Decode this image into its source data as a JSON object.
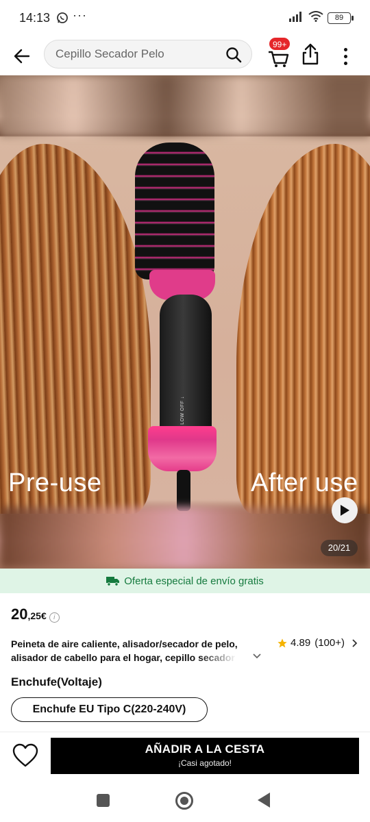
{
  "status_bar": {
    "time": "14:13",
    "battery": "89"
  },
  "header": {
    "search_placeholder": "Cepillo Secador Pelo",
    "cart_badge": "99+"
  },
  "gallery": {
    "caption_left": "Pre-use",
    "caption_right": "After use",
    "counter": "20/21",
    "brush_labels": "POWER MODE ↑ LOW OFF ↓"
  },
  "shipping_banner": {
    "text": "Oferta especial de envío gratis",
    "color": "#157a3e"
  },
  "product": {
    "price_int": "20",
    "price_dec": ",25€",
    "title": "Peineta de aire caliente, alisador/secador de pelo, alisador de cabello para el hogar, cepillo secador de pelo",
    "rating": "4.89",
    "reviews": "(100+)",
    "option_label": "Enchufe(Voltaje)",
    "option_selected": "Enchufe EU Tipo C(220-240V)"
  },
  "bottom_bar": {
    "add_to_cart": "AÑADIR A LA CESTA",
    "stock_note": "¡Casi agotado!"
  },
  "colors": {
    "accent": "#000000",
    "badge": "#e5262a",
    "brush_pink": "#e03c8a",
    "star": "#f5b301"
  }
}
